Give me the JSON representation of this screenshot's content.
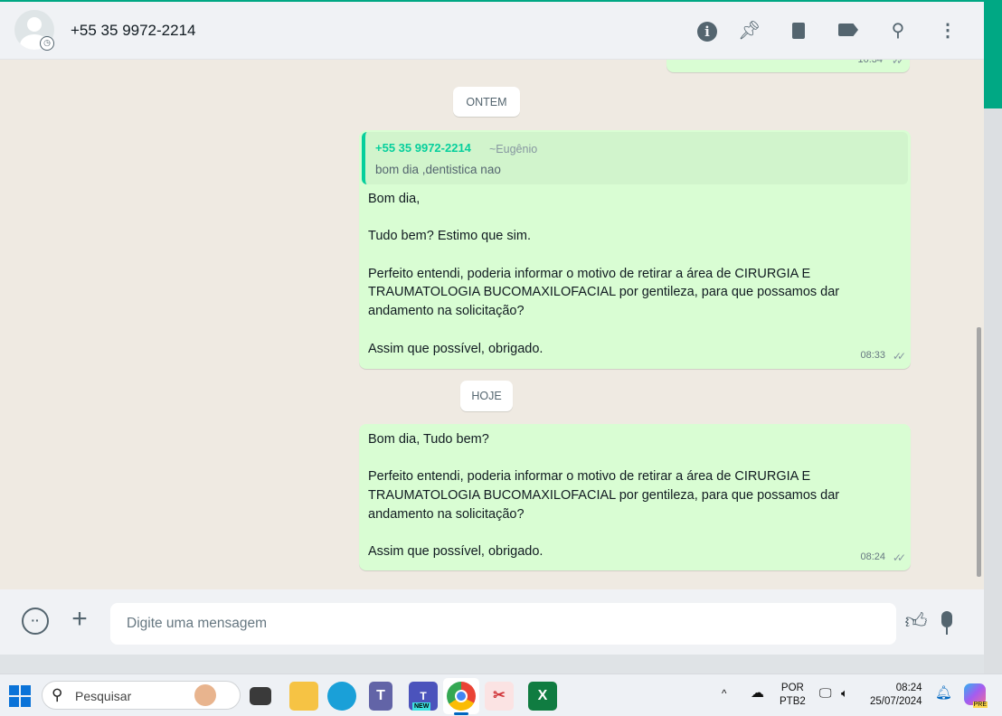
{
  "header": {
    "contact": "+55 35 9972-2214",
    "icons": [
      "info-icon",
      "pin-icon",
      "delete-icon",
      "label-icon",
      "search-icon",
      "menu-icon"
    ]
  },
  "chat": {
    "partial_time": "10:34",
    "date1": "ONTEM",
    "msg1": {
      "quote_author": "+55 35 9972-2214",
      "quote_name": "~Eugênio",
      "quote_text": "bom dia ,dentistica nao",
      "lines": [
        "Bom dia,",
        "",
        "Tudo bem? Estimo que sim.",
        "",
        "Perfeito entendi, poderia informar o motivo de retirar a área de CIRURGIA E",
        "TRAUMATOLOGIA BUCOMAXILOFACIAL por gentileza, para que possamos dar",
        "andamento na solicitação?",
        "",
        "Assim que possível, obrigado."
      ],
      "time": "08:33"
    },
    "date2": "HOJE",
    "msg2": {
      "lines": [
        "Bom dia, Tudo bem?",
        "",
        "Perfeito entendi, poderia informar o motivo de retirar a área de CIRURGIA E",
        "TRAUMATOLOGIA BUCOMAXILOFACIAL por gentileza, para que possamos dar",
        "andamento na solicitação?",
        "",
        "Assim que possível, obrigado."
      ],
      "time": "08:24"
    }
  },
  "footer": {
    "placeholder": "Digite uma mensagem"
  },
  "taskbar": {
    "search": "Pesquisar",
    "lang1": "POR",
    "lang2": "PTB2",
    "time": "08:24",
    "date": "25/07/2024",
    "badge_new": "NEW",
    "badge_pre": "PRE"
  },
  "colors": {
    "accent": "#00a884",
    "bubble": "#d9fdd3",
    "chat_bg": "#efeae2"
  }
}
